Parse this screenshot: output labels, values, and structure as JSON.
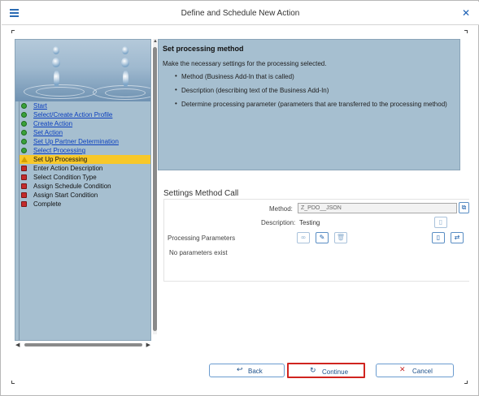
{
  "window": {
    "title": "Define and Schedule New Action",
    "menu_icon": "hamburger-menu-icon",
    "close_icon": "close-icon"
  },
  "steps": [
    {
      "label": "Start",
      "status": "done"
    },
    {
      "label": "Select/Create Action Profile",
      "status": "done"
    },
    {
      "label": "Create Action",
      "status": "done"
    },
    {
      "label": "Set Action",
      "status": "done"
    },
    {
      "label": "Set Up Partner Determination",
      "status": "done"
    },
    {
      "label": "Select Processing",
      "status": "done"
    },
    {
      "label": "Set Up Processing",
      "status": "current"
    },
    {
      "label": "Enter Action Description",
      "status": "pending"
    },
    {
      "label": "Select Condition Type",
      "status": "pending"
    },
    {
      "label": "Assign Schedule Condition",
      "status": "pending"
    },
    {
      "label": "Assign Start Condition",
      "status": "pending"
    },
    {
      "label": "Complete",
      "status": "pending"
    }
  ],
  "info": {
    "title": "Set processing method",
    "intro": "Make the necessary settings for the processing selected.",
    "bullets": [
      "Method (Business Add-In that is called)",
      "Description (describing text of the Business Add-In)",
      "Determine processing parameter (parameters that are transferred to the processing method)"
    ]
  },
  "settings": {
    "title": "Settings Method Call",
    "method_label": "Method:",
    "method_value": "Z_PDO__JSON",
    "description_label": "Description:",
    "description_value": "Testing",
    "params_label": "Processing Parameters",
    "no_params": "No parameters exist"
  },
  "buttons": {
    "back": "Back",
    "continue": "Continue",
    "cancel": "Cancel"
  },
  "colors": {
    "accent": "#1b5fab",
    "panel": "#a6bfd0",
    "current_step": "#f7c82a",
    "highlight_border": "#d0241f"
  }
}
